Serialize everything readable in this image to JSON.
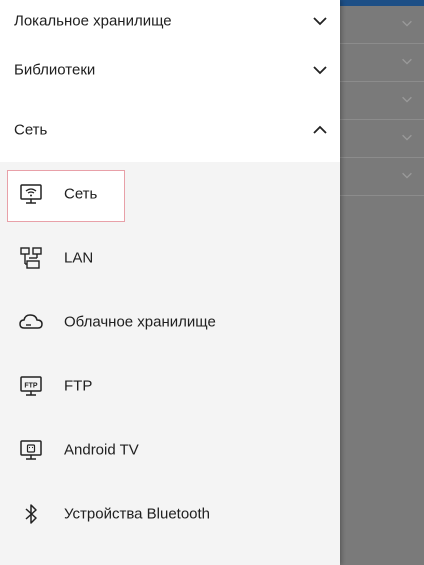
{
  "drawer": {
    "sections": [
      {
        "label": "Локальное хранилище",
        "expanded": false,
        "icon": "chevron-down-icon"
      },
      {
        "label": "Библиотеки",
        "expanded": false,
        "icon": "chevron-down-icon"
      },
      {
        "label": "Сеть",
        "expanded": true,
        "icon": "chevron-up-icon"
      }
    ],
    "network_items": [
      {
        "label": "Сеть",
        "icon": "network-monitor-icon",
        "selected": true
      },
      {
        "label": "LAN",
        "icon": "lan-icon",
        "selected": false
      },
      {
        "label": "Облачное хранилище",
        "icon": "cloud-icon",
        "selected": false
      },
      {
        "label": "FTP",
        "icon": "ftp-icon",
        "selected": false
      },
      {
        "label": "Android TV",
        "icon": "android-tv-icon",
        "selected": false
      },
      {
        "label": "Устройства Bluetooth",
        "icon": "bluetooth-icon",
        "selected": false
      }
    ]
  },
  "colors": {
    "drawer_bg": "#f4f4f4",
    "section_bg": "#ffffff",
    "text": "#202020",
    "selection_outline": "#e8a0a8",
    "backdrop": "#7a7a7a",
    "topbar": "#1d4f86"
  }
}
